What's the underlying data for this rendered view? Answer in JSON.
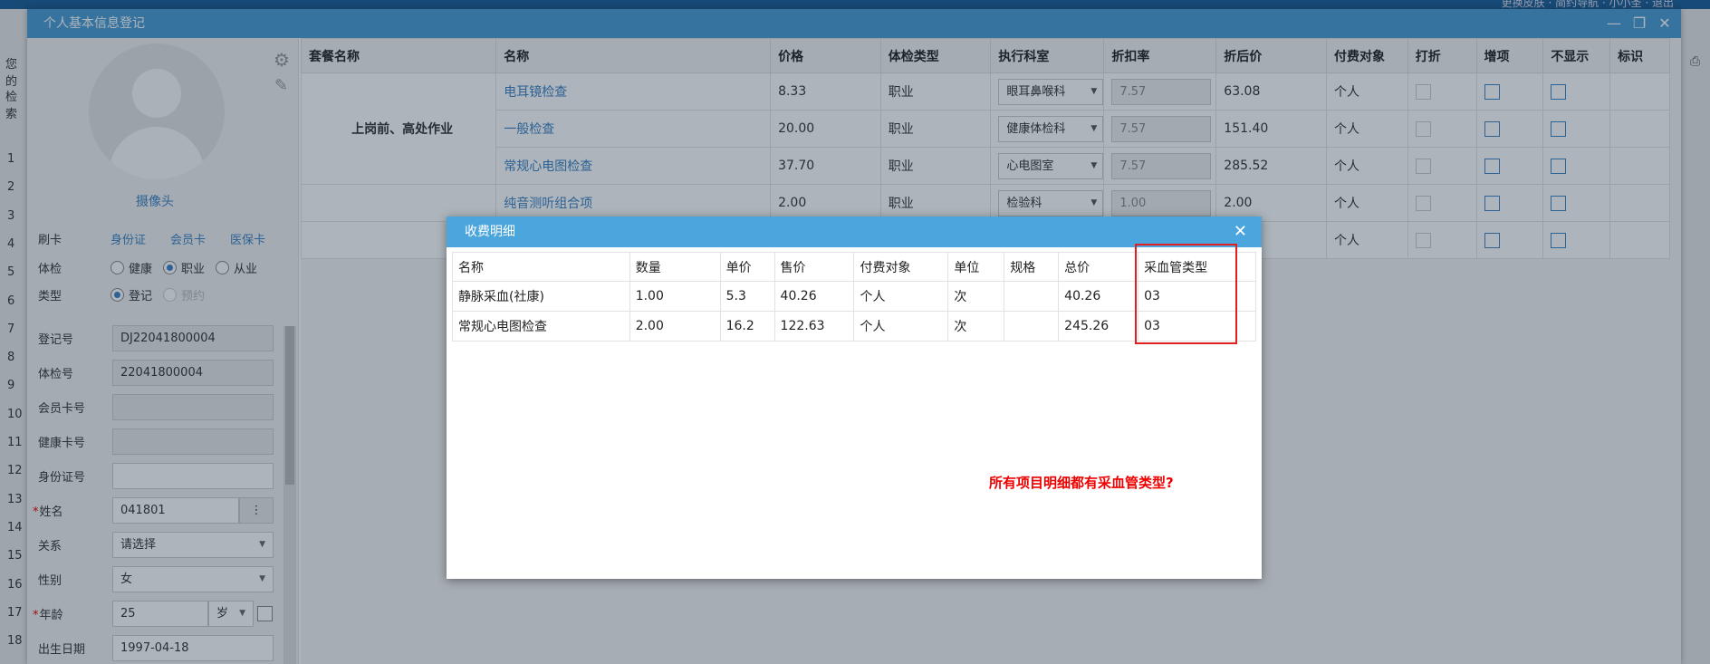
{
  "window": {
    "title": "个人基本信息登记",
    "controls": [
      "—",
      "❐",
      "✕"
    ]
  },
  "bg": {
    "top_links": "更换皮肤 · 简约导航 · 小小圣 · 退出",
    "left_labels": [
      "您的",
      "检索"
    ],
    "row_numbers": [
      "1",
      "2",
      "3",
      "4",
      "5",
      "6",
      "7",
      "8",
      "9",
      "10",
      "11",
      "12",
      "13",
      "14",
      "15",
      "16",
      "17",
      "18"
    ]
  },
  "left_panel": {
    "camera_label": "摄像头",
    "card_label": "刷卡",
    "card_links": [
      "身份证",
      "会员卡",
      "医保卡"
    ],
    "exam_type_label": "体检",
    "exam_type_options": [
      "健康",
      "职业",
      "从业"
    ],
    "exam_type_selected": "职业",
    "type_label": "类型",
    "type_options": [
      "登记",
      "预约"
    ],
    "fields": {
      "reg_no": {
        "label": "登记号",
        "value": "DJ22041800004"
      },
      "exam_no": {
        "label": "体检号",
        "value": "22041800004"
      },
      "member_card": {
        "label": "会员卡号",
        "value": ""
      },
      "health_card": {
        "label": "健康卡号",
        "value": ""
      },
      "id_no": {
        "label": "身份证号",
        "value": ""
      },
      "name": {
        "label": "姓名",
        "value": "041801"
      },
      "relation": {
        "label": "关系",
        "value": "请选择"
      },
      "gender": {
        "label": "性别",
        "value": "女"
      },
      "age": {
        "label": "年龄",
        "value": "25",
        "unit": "岁"
      },
      "birth": {
        "label": "出生日期",
        "value": "1997-04-18"
      }
    }
  },
  "package_table": {
    "headers": [
      "套餐名称",
      "名称",
      "价格",
      "体检类型",
      "执行科室",
      "折扣率",
      "折后价",
      "付费对象",
      "打折",
      "增项",
      "不显示",
      "标识"
    ],
    "group_name": "上岗前、高处作业",
    "rows": [
      {
        "name": "电耳镜检查",
        "price": "8.33",
        "type": "职业",
        "dept": "眼耳鼻喉科",
        "rate": "7.57",
        "after": "63.08",
        "payer": "个人"
      },
      {
        "name": "一般检查",
        "price": "20.00",
        "type": "职业",
        "dept": "健康体检科",
        "rate": "7.57",
        "after": "151.40",
        "payer": "个人"
      },
      {
        "name": "常规心电图检查",
        "price": "37.70",
        "type": "职业",
        "dept": "心电图室",
        "rate": "7.57",
        "after": "285.52",
        "payer": "个人"
      },
      {
        "name": "纯音测听组合项",
        "price": "2.00",
        "type": "职业",
        "dept": "检验科",
        "rate": "1.00",
        "after": "2.00",
        "payer": "个人"
      },
      {
        "name": "",
        "price": "",
        "type": "",
        "dept": "",
        "rate": "",
        "after": "",
        "payer": "个人"
      }
    ]
  },
  "modal": {
    "title": "收费明细",
    "headers": [
      "名称",
      "数量",
      "单价",
      "售价",
      "付费对象",
      "单位",
      "规格",
      "总价",
      "采血管类型"
    ],
    "rows": [
      [
        "静脉采血(社康)",
        "1.00",
        "5.3",
        "40.26",
        "个人",
        "次",
        "",
        "40.26",
        "03"
      ],
      [
        "常规心电图检查",
        "2.00",
        "16.2",
        "122.63",
        "个人",
        "次",
        "",
        "245.26",
        "03"
      ]
    ],
    "note": "所有项目明细都有采血管类型?",
    "highlight_color": "#e02020"
  },
  "colors": {
    "accent": "#4a9bd4",
    "link": "#3b82c4",
    "alert": "#e00000"
  }
}
